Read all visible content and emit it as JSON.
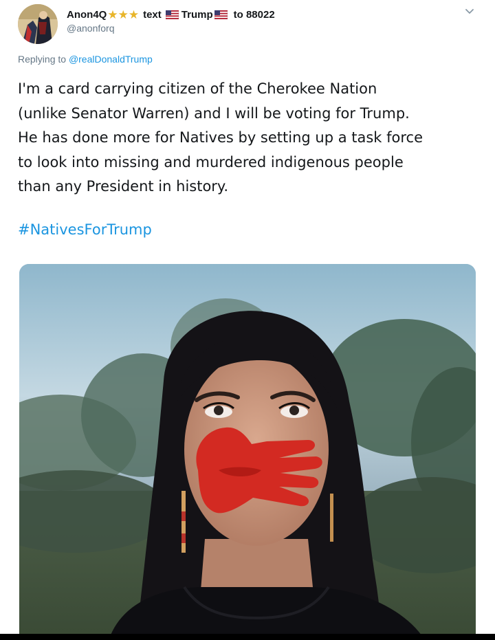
{
  "author": {
    "display_name": "Anon4Q",
    "stars": [
      "★",
      "★",
      "★"
    ],
    "name_suffix_1": "text",
    "name_suffix_2": "Trump",
    "name_suffix_3": "to 88022",
    "handle": "@anonforq",
    "avatar_icon": "avatar-portrait-icon"
  },
  "reply": {
    "prefix": "Replying to",
    "mention": "@realDonaldTrump"
  },
  "tweet": {
    "lines": [
      "I'm a card carrying citizen of the Cherokee Nation",
      "(unlike Senator Warren) and I will be voting for Trump.",
      "He has done more for Natives by setting up a task force",
      "to look into missing and murdered indigenous people",
      "than any President in history."
    ],
    "hashtag": "#NativesForTrump"
  },
  "media": {
    "icon": "photo-woman-red-handprint-icon"
  },
  "colors": {
    "text": "#14171a",
    "muted": "#657786",
    "link": "#1b95e0",
    "star": "#e8b52a",
    "handprint": "#d32a22"
  }
}
